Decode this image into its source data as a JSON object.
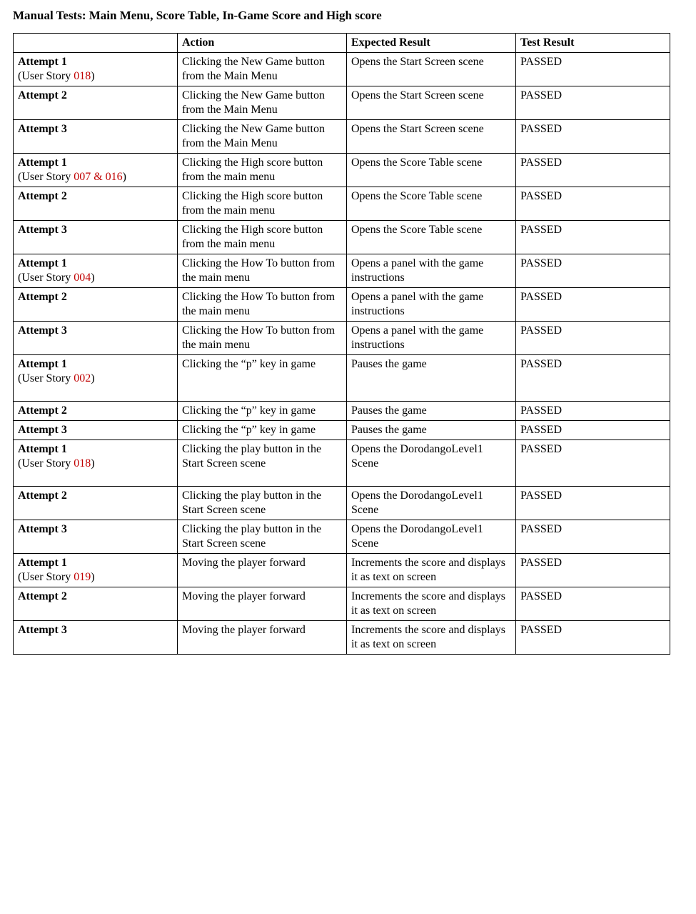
{
  "title": "Manual Tests: Main Menu, Score Table, In-Game Score and High score",
  "headers": {
    "col1": "",
    "col2": "Action",
    "col3": "Expected Result",
    "col4": "Test Result"
  },
  "userStoryPrefix": "(User Story ",
  "userStorySuffix": ")",
  "rows": [
    {
      "attempt": "Attempt 1",
      "userStory": "018",
      "action": "Clicking the New Game button from the Main Menu",
      "expected": "Opens the Start Screen scene",
      "result": "PASSED",
      "tall": false
    },
    {
      "attempt": "Attempt 2",
      "userStory": "",
      "action": "Clicking the New Game button from the Main Menu",
      "expected": "Opens the Start Screen scene",
      "result": "PASSED",
      "tall": false
    },
    {
      "attempt": "Attempt 3",
      "userStory": "",
      "action": "Clicking the New Game button from the Main Menu",
      "expected": "Opens the Start Screen scene",
      "result": "PASSED",
      "tall": false
    },
    {
      "attempt": "Attempt 1",
      "userStory": "007 & 016",
      "action": "Clicking the High score button from the main menu",
      "expected": "Opens the Score Table scene",
      "result": "PASSED",
      "tall": false
    },
    {
      "attempt": "Attempt 2",
      "userStory": "",
      "action": "Clicking the High score button from the main menu",
      "expected": "Opens the Score Table scene",
      "result": "PASSED",
      "tall": false
    },
    {
      "attempt": "Attempt 3",
      "userStory": "",
      "action": "Clicking the High score button from the main menu",
      "expected": "Opens the Score Table scene",
      "result": "PASSED",
      "tall": false
    },
    {
      "attempt": "Attempt 1",
      "userStory": "004",
      "action": "Clicking the How To button from the main menu",
      "expected": "Opens a panel with the game instructions",
      "result": "PASSED",
      "tall": false
    },
    {
      "attempt": "Attempt 2",
      "userStory": "",
      "action": "Clicking the How To button from the main menu",
      "expected": "Opens a panel with the game instructions",
      "result": "PASSED",
      "tall": false
    },
    {
      "attempt": "Attempt 3",
      "userStory": "",
      "action": "Clicking the How To button from the main menu",
      "expected": "Opens a panel with the game instructions",
      "result": "PASSED",
      "tall": false
    },
    {
      "attempt": "Attempt 1",
      "userStory": "002",
      "action": "Clicking the “p” key in game",
      "expected": "Pauses the game",
      "result": "PASSED",
      "tall": true
    },
    {
      "attempt": "Attempt 2",
      "userStory": "",
      "action": "Clicking the “p” key in game",
      "expected": "Pauses the game",
      "result": "PASSED",
      "tall": false
    },
    {
      "attempt": "Attempt 3",
      "userStory": "",
      "action": "Clicking the “p” key in game",
      "expected": "Pauses the game",
      "result": "PASSED",
      "tall": false
    },
    {
      "attempt": "Attempt 1",
      "userStory": "018",
      "action": "Clicking the play button in the Start Screen scene",
      "expected": "Opens the DorodangoLevel1 Scene",
      "result": "PASSED",
      "tall": true
    },
    {
      "attempt": "Attempt 2",
      "userStory": "",
      "action": "Clicking the play button in the Start Screen scene",
      "expected": "Opens the DorodangoLevel1 Scene",
      "result": "PASSED",
      "tall": false
    },
    {
      "attempt": "Attempt 3",
      "userStory": "",
      "action": "Clicking the play button in the Start Screen scene",
      "expected": "Opens the DorodangoLevel1 Scene",
      "result": "PASSED",
      "tall": false
    },
    {
      "attempt": "Attempt 1",
      "userStory": "019",
      "action": "Moving the player forward",
      "expected": "Increments the score and displays it as text on screen",
      "result": "PASSED",
      "tall": false
    },
    {
      "attempt": "Attempt 2",
      "userStory": "",
      "action": "Moving the player forward",
      "expected": "Increments the score and displays it as text on screen",
      "result": "PASSED",
      "tall": false
    },
    {
      "attempt": "Attempt 3",
      "userStory": "",
      "action": "Moving the player forward",
      "expected": "Increments the score and displays it as text on screen",
      "result": "PASSED",
      "tall": false
    }
  ]
}
